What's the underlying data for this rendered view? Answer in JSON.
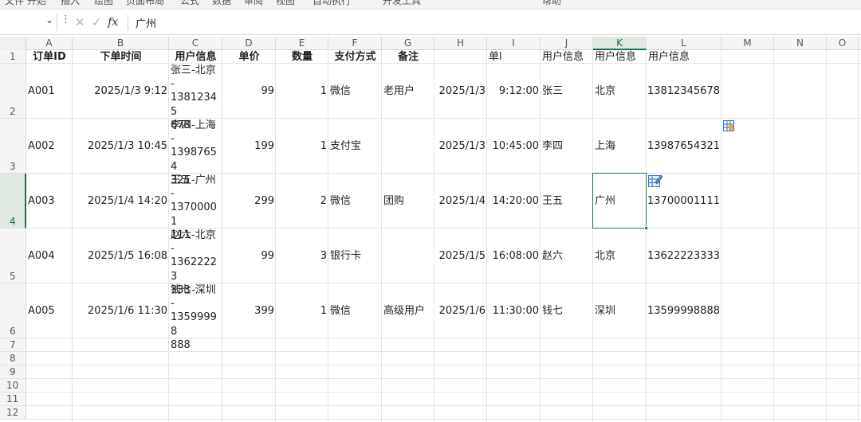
{
  "ribbon": {
    "tabs": [
      "文件",
      "开始",
      "插入",
      "绘图",
      "页面布局",
      "公式",
      "数据",
      "审阅",
      "视图",
      "自动执行",
      "开发工具",
      "帮助"
    ]
  },
  "formula_bar": {
    "name_box_value": "",
    "content": "广州"
  },
  "sheet": {
    "column_headers": [
      "A",
      "B",
      "C",
      "D",
      "E",
      "F",
      "G",
      "H",
      "I",
      "J",
      "K",
      "L",
      "M",
      "N",
      "O"
    ],
    "selected_column": "K",
    "row_numbers": [
      "1",
      "2",
      "3",
      "4",
      "5",
      "6",
      "7",
      "8",
      "9",
      "10",
      "11",
      "12"
    ],
    "selected_row": "4",
    "header_row": {
      "A": "订单ID",
      "B": "下单时间",
      "C": "用户信息",
      "D": "单价",
      "E": "数量",
      "F": "支付方式",
      "G": "备注",
      "H": "",
      "I": "单l",
      "J": "用户信息",
      "K": "用户信息",
      "L": "用户信息"
    },
    "rows": [
      {
        "A": "A001",
        "B": "2025/1/3 9:12",
        "C": "张三-北京-13812345678",
        "D": "99",
        "E": "1",
        "F": "微信",
        "G": "老用户",
        "H": "2025/1/3",
        "I": "9:12:00",
        "J": "张三",
        "K": "北京",
        "L": "13812345678"
      },
      {
        "A": "A002",
        "B": "2025/1/3 10:45",
        "C": "李四-上海-13987654321",
        "D": "199",
        "E": "1",
        "F": "支付宝",
        "G": "",
        "H": "2025/1/3",
        "I": "10:45:00",
        "J": "李四",
        "K": "上海",
        "L": "13987654321"
      },
      {
        "A": "A003",
        "B": "2025/1/4 14:20",
        "C": "王五-广州-13700001111",
        "D": "299",
        "E": "2",
        "F": "微信",
        "G": "团购",
        "H": "2025/1/4",
        "I": "14:20:00",
        "J": "王五",
        "K": "广州",
        "L": "13700001111"
      },
      {
        "A": "A004",
        "B": "2025/1/5 16:08",
        "C": "赵六-北京-13622223333",
        "D": "99",
        "E": "3",
        "F": "银行卡",
        "G": "",
        "H": "2025/1/5",
        "I": "16:08:00",
        "J": "赵六",
        "K": "北京",
        "L": "13622223333"
      },
      {
        "A": "A005",
        "B": "2025/1/6 11:30",
        "C": "钱七-深圳-13599998888",
        "D": "399",
        "E": "1",
        "F": "微信",
        "G": "高级用户",
        "H": "2025/1/6",
        "I": "11:30:00",
        "J": "钱七",
        "K": "深圳",
        "L": "13599998888"
      }
    ],
    "wrapped_c": [
      [
        "张三-北京",
        "-",
        "13812345",
        "678"
      ],
      [
        "李四-上海",
        "-",
        "13987654",
        "321"
      ],
      [
        "王五-广州",
        "-",
        "13700001",
        "111"
      ],
      [
        "赵六-北京",
        "-",
        "13622223",
        "333"
      ],
      [
        "钱七-深圳",
        "-",
        "13599998",
        "888"
      ]
    ],
    "active_cell": "K4",
    "icons": {
      "quick_analysis": "quick-analysis-icon",
      "flash_fill": "flash-fill-icon",
      "accent": "#217346"
    }
  }
}
